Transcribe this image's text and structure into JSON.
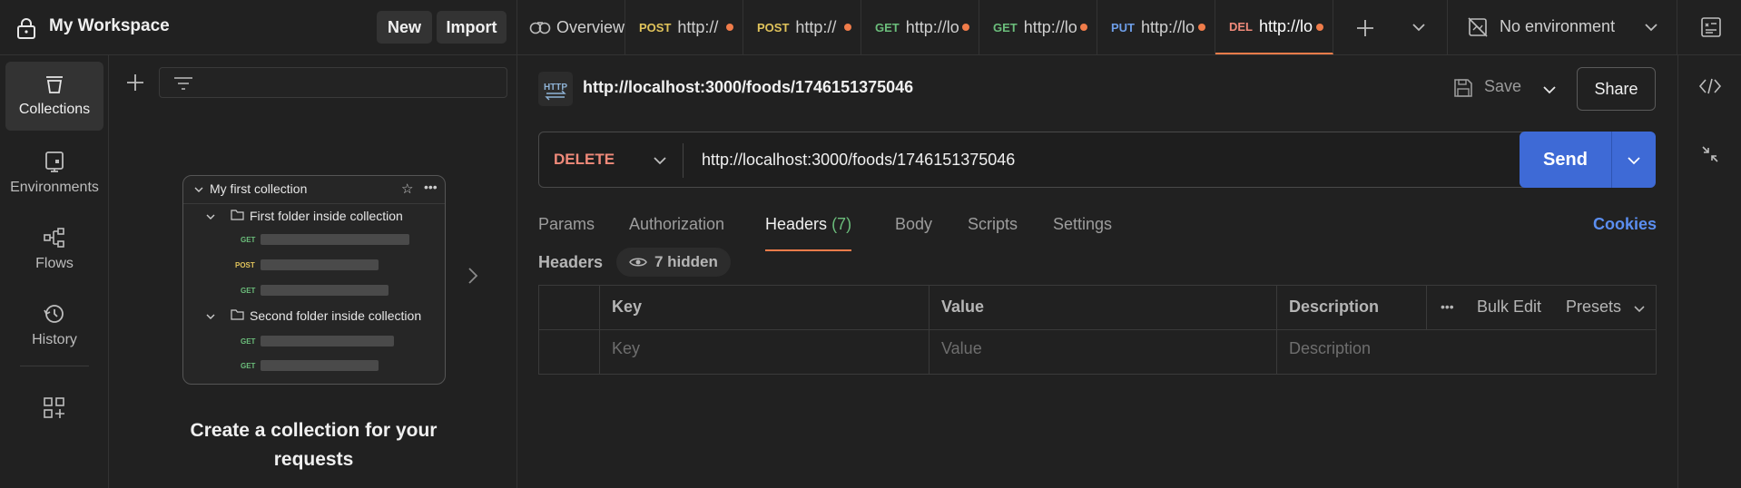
{
  "workspace": {
    "title": "My Workspace",
    "new_label": "New",
    "import_label": "Import"
  },
  "tabs": [
    {
      "method": "",
      "label": "Overview",
      "icon": "overview-icon"
    },
    {
      "method": "POST",
      "label": "http://",
      "dirty": true
    },
    {
      "method": "POST",
      "label": "http://",
      "dirty": true
    },
    {
      "method": "GET",
      "label": "http://lo",
      "dirty": true
    },
    {
      "method": "GET",
      "label": "http://lo",
      "dirty": true
    },
    {
      "method": "PUT",
      "label": "http://lo",
      "dirty": true
    },
    {
      "method": "DEL",
      "label": "http://lo",
      "dirty": true,
      "active": true
    }
  ],
  "environment": {
    "label": "No environment"
  },
  "rail": [
    {
      "label": "Collections",
      "icon": "collections-icon",
      "active": true
    },
    {
      "label": "Environments",
      "icon": "environments-icon"
    },
    {
      "label": "Flows",
      "icon": "flows-icon"
    },
    {
      "label": "History",
      "icon": "history-icon"
    }
  ],
  "sidebar": {
    "card": {
      "collection": "My first collection",
      "folder1": "First folder inside collection",
      "folder2": "Second folder inside collection",
      "m1": "GET",
      "m2": "POST",
      "m3": "GET",
      "m4": "GET",
      "m5": "GET"
    },
    "empty_title_line1": "Create a collection for your",
    "empty_title_line2": "requests"
  },
  "request": {
    "title": "http://localhost:3000/foods/1746151375046",
    "save_label": "Save",
    "share_label": "Share",
    "method": "DELETE",
    "url": "http://localhost:3000/foods/1746151375046",
    "send_label": "Send"
  },
  "req_tabs": {
    "params": "Params",
    "authorization": "Authorization",
    "headers": "Headers",
    "headers_count": "(7)",
    "body": "Body",
    "scripts": "Scripts",
    "settings": "Settings",
    "cookies": "Cookies"
  },
  "headers": {
    "label": "Headers",
    "hidden": "7 hidden",
    "col_key": "Key",
    "col_value": "Value",
    "col_description": "Description",
    "bulk_edit": "Bulk Edit",
    "presets": "Presets",
    "ph_key": "Key",
    "ph_value": "Value",
    "ph_description": "Description"
  },
  "colors": {
    "accent": "#f07c4a",
    "send": "#3e6ad6",
    "delete": "#f08a7a",
    "cookies": "#5b8ef0"
  }
}
